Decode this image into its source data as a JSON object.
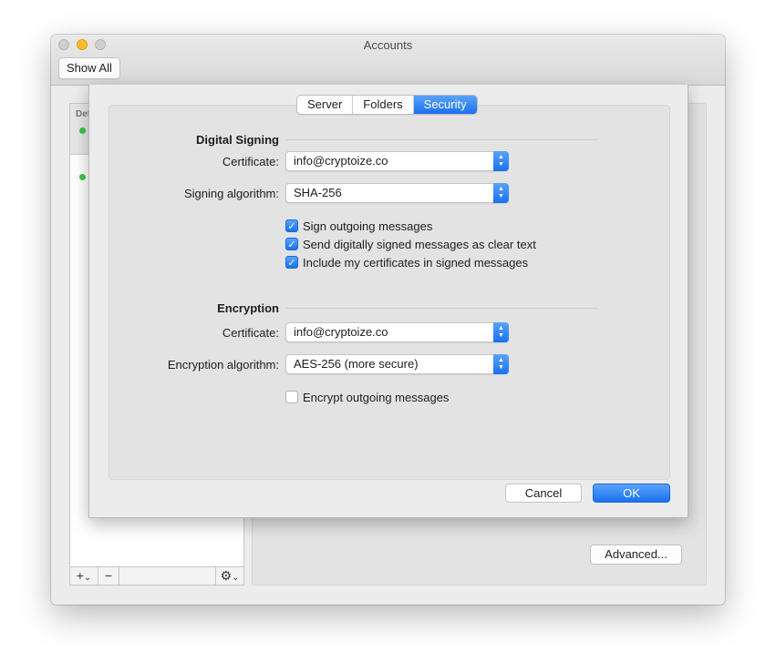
{
  "window": {
    "title": "Accounts",
    "show_all_label": "Show All"
  },
  "sidebar": {
    "header_text": "Det",
    "toolbar": {
      "add": "+",
      "add_chevron": "⌄",
      "remove": "−",
      "gear": "⚙",
      "gear_chevron": "⌄"
    }
  },
  "detail": {
    "advanced_label": "Advanced..."
  },
  "sheet": {
    "tabs": [
      {
        "label": "Server",
        "active": false
      },
      {
        "label": "Folders",
        "active": false
      },
      {
        "label": "Security",
        "active": true
      }
    ],
    "digital_signing": {
      "title": "Digital Signing",
      "certificate_label": "Certificate:",
      "certificate_value": "info@cryptoize.co",
      "algorithm_label": "Signing algorithm:",
      "algorithm_value": "SHA-256",
      "options": [
        {
          "label": "Sign outgoing messages",
          "checked": true
        },
        {
          "label": "Send digitally signed messages as clear text",
          "checked": true
        },
        {
          "label": "Include my certificates in signed messages",
          "checked": true
        }
      ]
    },
    "encryption": {
      "title": "Encryption",
      "certificate_label": "Certificate:",
      "certificate_value": "info@cryptoize.co",
      "algorithm_label": "Encryption algorithm:",
      "algorithm_value": "AES-256 (more secure)",
      "options": [
        {
          "label": "Encrypt outgoing messages",
          "checked": false
        }
      ]
    },
    "cancel_label": "Cancel",
    "ok_label": "OK"
  },
  "colors": {
    "accent": "#1a71ef",
    "status_green": "#37c94a",
    "traffic_yellow": "#fcbb2c"
  }
}
